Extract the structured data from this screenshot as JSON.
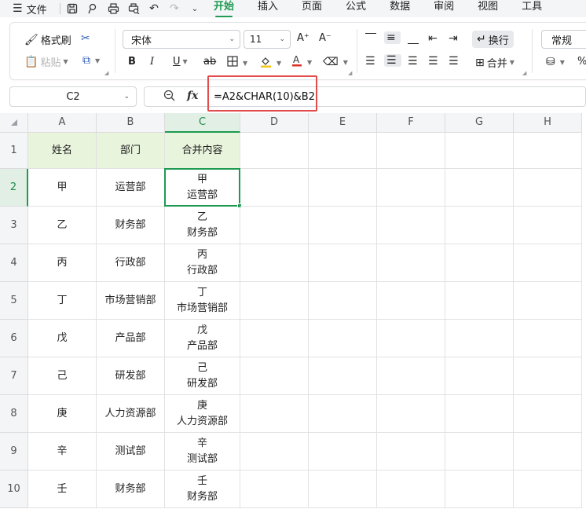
{
  "menubar": {
    "file_label": "文件",
    "tabs": [
      {
        "label": "开始",
        "active": true
      },
      {
        "label": "插入",
        "active": false
      },
      {
        "label": "页面",
        "active": false
      },
      {
        "label": "公式",
        "active": false
      },
      {
        "label": "数据",
        "active": false
      },
      {
        "label": "审阅",
        "active": false
      },
      {
        "label": "视图",
        "active": false
      },
      {
        "label": "工具",
        "active": false
      }
    ]
  },
  "ribbon": {
    "format_painter": "格式刷",
    "paste": "粘贴",
    "font_name": "宋体",
    "font_size": "11",
    "bold": "B",
    "italic": "I",
    "underline": "U",
    "strikethrough": "ab",
    "wrap_text": "换行",
    "merge": "合并",
    "number_format": "常规",
    "grow_font": "A⁺",
    "shrink_font": "A⁻",
    "percent": "%"
  },
  "formula_bar": {
    "name_box": "C2",
    "fx_label": "fx",
    "formula": "=A2&CHAR(10)&B2"
  },
  "sheet": {
    "columns": [
      "A",
      "B",
      "C",
      "D",
      "E",
      "F",
      "G",
      "H"
    ],
    "selected_column": "C",
    "selected_row": "2",
    "header_row": {
      "row": "1",
      "cells": [
        "姓名",
        "部门",
        "合并内容"
      ]
    },
    "rows": [
      {
        "row": "2",
        "name": "甲",
        "dept": "运营部",
        "merged": [
          "甲",
          "运营部"
        ]
      },
      {
        "row": "3",
        "name": "乙",
        "dept": "财务部",
        "merged": [
          "乙",
          "财务部"
        ]
      },
      {
        "row": "4",
        "name": "丙",
        "dept": "行政部",
        "merged": [
          "丙",
          "行政部"
        ]
      },
      {
        "row": "5",
        "name": "丁",
        "dept": "市场营销部",
        "merged": [
          "丁",
          "市场营销部"
        ]
      },
      {
        "row": "6",
        "name": "戊",
        "dept": "产品部",
        "merged": [
          "戊",
          "产品部"
        ]
      },
      {
        "row": "7",
        "name": "己",
        "dept": "研发部",
        "merged": [
          "己",
          "研发部"
        ]
      },
      {
        "row": "8",
        "name": "庚",
        "dept": "人力资源部",
        "merged": [
          "庚",
          "人力资源部"
        ]
      },
      {
        "row": "9",
        "name": "辛",
        "dept": "测试部",
        "merged": [
          "辛",
          "测试部"
        ]
      },
      {
        "row": "10",
        "name": "壬",
        "dept": "财务部",
        "merged": [
          "壬",
          "财务部"
        ]
      }
    ]
  },
  "colors": {
    "accent": "#1f9a52",
    "header_fill": "#e8f4dc",
    "highlight_box": "#e24c4c"
  }
}
